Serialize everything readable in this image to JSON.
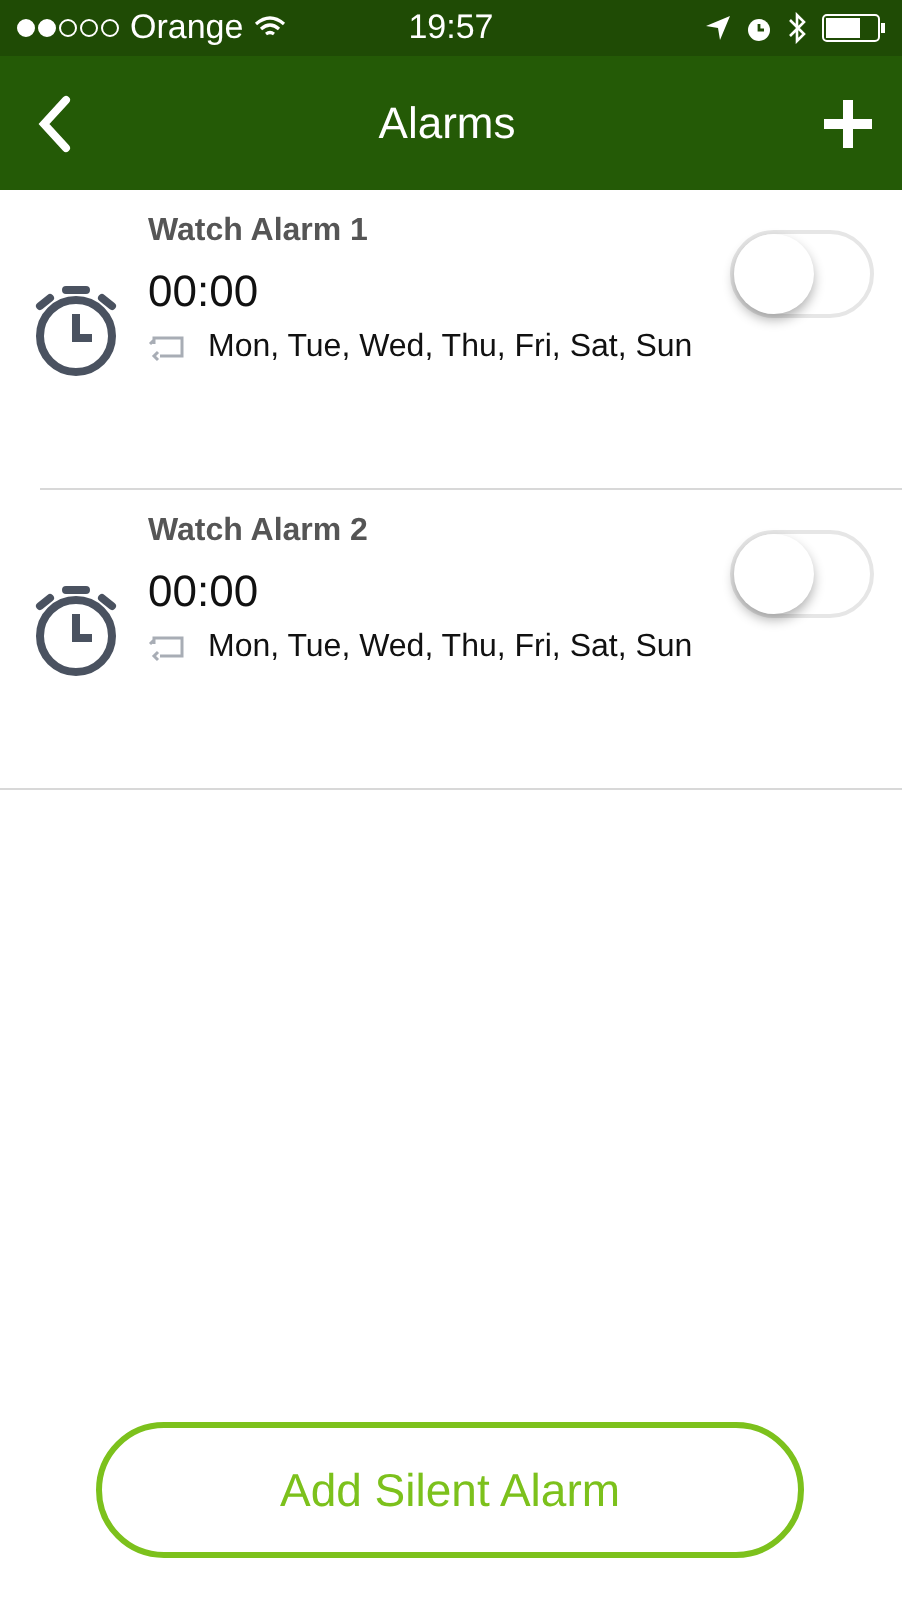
{
  "status_bar": {
    "carrier": "Orange",
    "time": "19:57"
  },
  "nav": {
    "title": "Alarms"
  },
  "alarms": [
    {
      "name": "Watch Alarm 1",
      "time": "00:00",
      "days": "Mon, Tue, Wed, Thu, Fri, Sat, Sun",
      "on": false
    },
    {
      "name": "Watch Alarm 2",
      "time": "00:00",
      "days": "Mon, Tue, Wed, Thu, Fri, Sat, Sun",
      "on": false
    }
  ],
  "add_button": "Add Silent Alarm"
}
